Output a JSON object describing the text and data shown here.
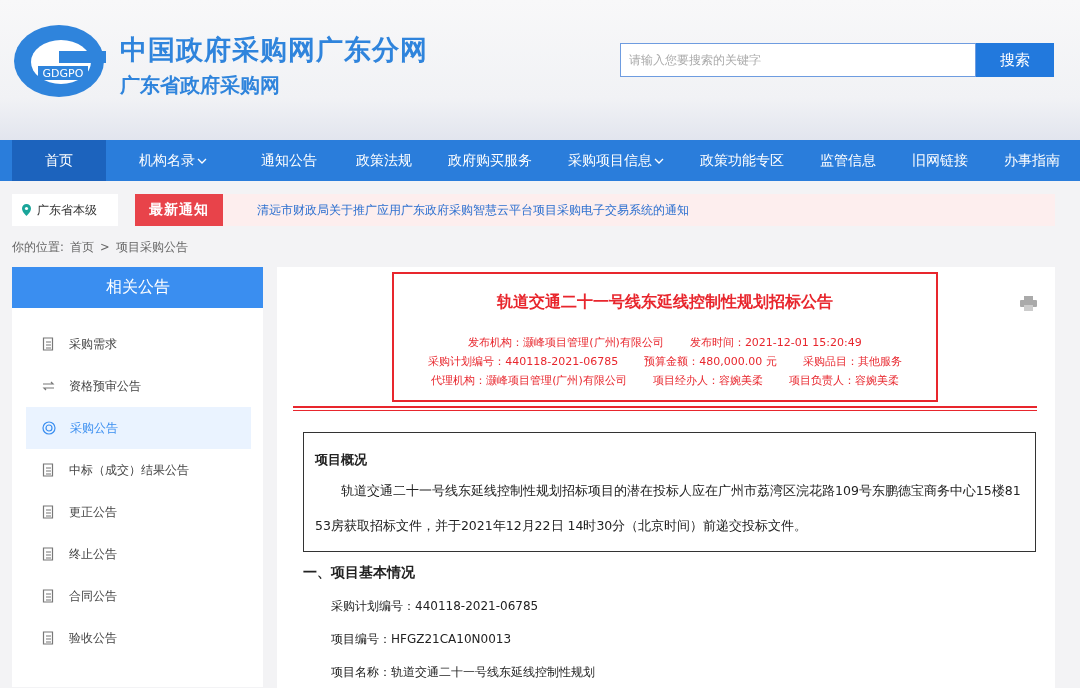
{
  "site": {
    "logo_text": "GDGPO",
    "title": "中国政府采购网广东分网",
    "subtitle": "广东省政府采购网"
  },
  "search": {
    "placeholder": "请输入您要搜索的关键字",
    "button": "搜索"
  },
  "nav": [
    {
      "label": "首页",
      "selected": true,
      "dropdown": false
    },
    {
      "label": "机构名录",
      "selected": false,
      "dropdown": true
    },
    {
      "label": "通知公告",
      "selected": false,
      "dropdown": false
    },
    {
      "label": "政策法规",
      "selected": false,
      "dropdown": false
    },
    {
      "label": "政府购买服务",
      "selected": false,
      "dropdown": false
    },
    {
      "label": "采购项目信息",
      "selected": false,
      "dropdown": true
    },
    {
      "label": "政策功能专区",
      "selected": false,
      "dropdown": false
    },
    {
      "label": "监管信息",
      "selected": false,
      "dropdown": false
    },
    {
      "label": "旧网链接",
      "selected": false,
      "dropdown": false
    },
    {
      "label": "办事指南",
      "selected": false,
      "dropdown": false
    }
  ],
  "region": "广东省本级",
  "notice": {
    "badge": "最新通知",
    "text": "清远市财政局关于推广应用广东政府采购智慧云平台项目采购电子交易系统的通知"
  },
  "breadcrumb": {
    "prefix": "你的位置:",
    "items": [
      "首页",
      ">",
      "项目采购公告"
    ]
  },
  "sidebar": {
    "title": "相关公告",
    "items": [
      {
        "label": "采购需求",
        "selected": false
      },
      {
        "label": "资格预审公告",
        "selected": false
      },
      {
        "label": "采购公告",
        "selected": true
      },
      {
        "label": "中标（成交）结果公告",
        "selected": false
      },
      {
        "label": "更正公告",
        "selected": false
      },
      {
        "label": "终止公告",
        "selected": false
      },
      {
        "label": "合同公告",
        "selected": false
      },
      {
        "label": "验收公告",
        "selected": false
      }
    ]
  },
  "article": {
    "title": "轨道交通二十一号线东延线控制性规划招标公告",
    "meta": [
      [
        "发布机构：灏峰项目管理(广州)有限公司",
        "发布时间：2021-12-01 15:20:49"
      ],
      [
        "采购计划编号：440118-2021-06785",
        "预算金额：480,000.00 元",
        "采购品目：其他服务"
      ],
      [
        "代理机构：灏峰项目管理(广州)有限公司",
        "项目经办人：容婉美柔",
        "项目负责人：容婉美柔"
      ]
    ],
    "summary_title": "项目概况",
    "summary": "轨道交通二十一号线东延线控制性规划招标项目的潜在投标人应在广州市荔湾区浣花路109号东鹏德宝商务中心15楼8153房获取招标文件，并于2021年12月22日 14时30分（北京时间）前递交投标文件。",
    "section_title": "一、项目基本情况",
    "lines": [
      "采购计划编号：440118-2021-06785",
      "项目编号：HFGZ21CA10N0013",
      "项目名称：轨道交通二十一号线东延线控制性规划"
    ]
  }
}
